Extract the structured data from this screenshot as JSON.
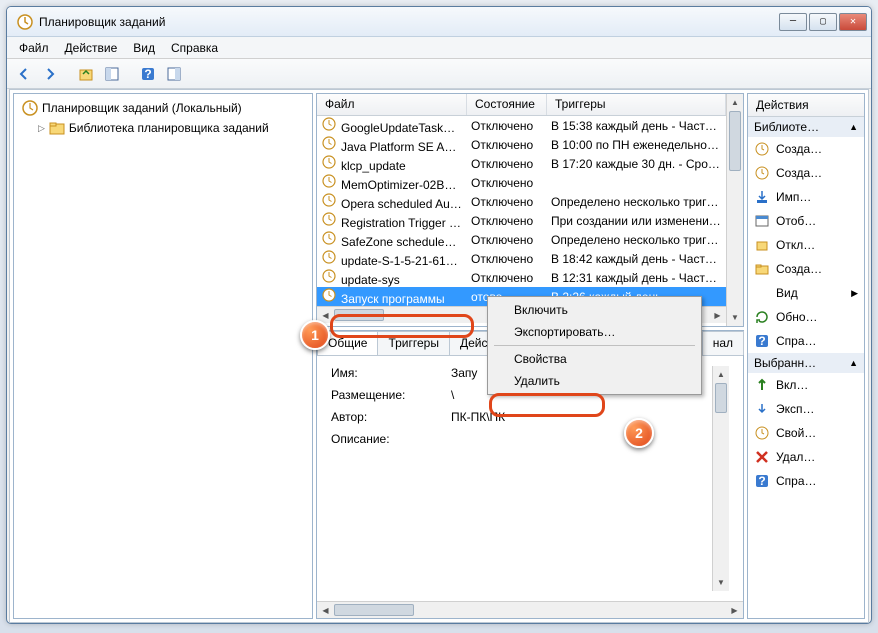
{
  "window": {
    "title": "Планировщик заданий"
  },
  "menu": {
    "file": "Файл",
    "action": "Действие",
    "view": "Вид",
    "help": "Справка"
  },
  "tree": {
    "root": "Планировщик заданий (Локальный)",
    "child": "Библиотека планировщика заданий"
  },
  "grid": {
    "headers": {
      "name": "Файл",
      "state": "Состояние",
      "triggers": "Триггеры"
    },
    "rows": [
      {
        "name": "GoogleUpdateTask…",
        "state": "Отключено",
        "trig": "В 15:38 каждый день - Частота…"
      },
      {
        "name": "Java Platform SE Au…",
        "state": "Отключено",
        "trig": "В 10:00 по ПН еженедельно, н…"
      },
      {
        "name": "klcp_update",
        "state": "Отключено",
        "trig": "В 17:20 каждые 30 дн. - Срок и…"
      },
      {
        "name": "MemOptimizer-02B…",
        "state": "Отключено",
        "trig": ""
      },
      {
        "name": "Opera scheduled Au…",
        "state": "Отключено",
        "trig": "Определено несколько тригг…"
      },
      {
        "name": "Registration Trigger …",
        "state": "Отключено",
        "trig": "При создании или изменении…"
      },
      {
        "name": "SafeZone scheduled…",
        "state": "Отключено",
        "trig": "Определено несколько тригг…"
      },
      {
        "name": "update-S-1-5-21-61…",
        "state": "Отключено",
        "trig": "В 18:42 каждый день - Частота…"
      },
      {
        "name": "update-sys",
        "state": "Отключено",
        "trig": "В 12:31 каждый день - Частота…"
      },
      {
        "name": "Запуск программы",
        "state": "отово",
        "trig": "В 2:26 каждый день"
      }
    ]
  },
  "ctx": {
    "enable": "Включить",
    "export": "Экспортировать…",
    "props": "Свойства",
    "delete": "Удалить"
  },
  "tabs": {
    "general": "Общие",
    "triggers": "Триггеры",
    "actions": "Дейст",
    "history": "нал"
  },
  "form": {
    "name_label": "Имя:",
    "name_val": "Запу",
    "location_label": "Размещение:",
    "location_val": "\\",
    "author_label": "Автор:",
    "author_val": "ПК-ПК\\ПК",
    "desc_label": "Описание:"
  },
  "actions": {
    "header": "Действия",
    "group1": "Библиоте…",
    "items1": [
      {
        "icon": "new-task",
        "label": "Созда…"
      },
      {
        "icon": "new-task",
        "label": "Созда…"
      },
      {
        "icon": "import",
        "label": "Имп…"
      },
      {
        "icon": "show",
        "label": "Отоб…"
      },
      {
        "icon": "disable",
        "label": "Откл…"
      },
      {
        "icon": "folder",
        "label": "Созда…"
      },
      {
        "icon": "view",
        "label": "Вид"
      },
      {
        "icon": "refresh",
        "label": "Обно…"
      },
      {
        "icon": "help",
        "label": "Спра…"
      }
    ],
    "group2": "Выбранн…",
    "items2": [
      {
        "icon": "enable",
        "label": "Вкл…"
      },
      {
        "icon": "export",
        "label": "Эксп…"
      },
      {
        "icon": "props",
        "label": "Свой…"
      },
      {
        "icon": "delete",
        "label": "Удал…"
      },
      {
        "icon": "help",
        "label": "Спра…"
      }
    ]
  },
  "callouts": {
    "one": "1",
    "two": "2"
  }
}
